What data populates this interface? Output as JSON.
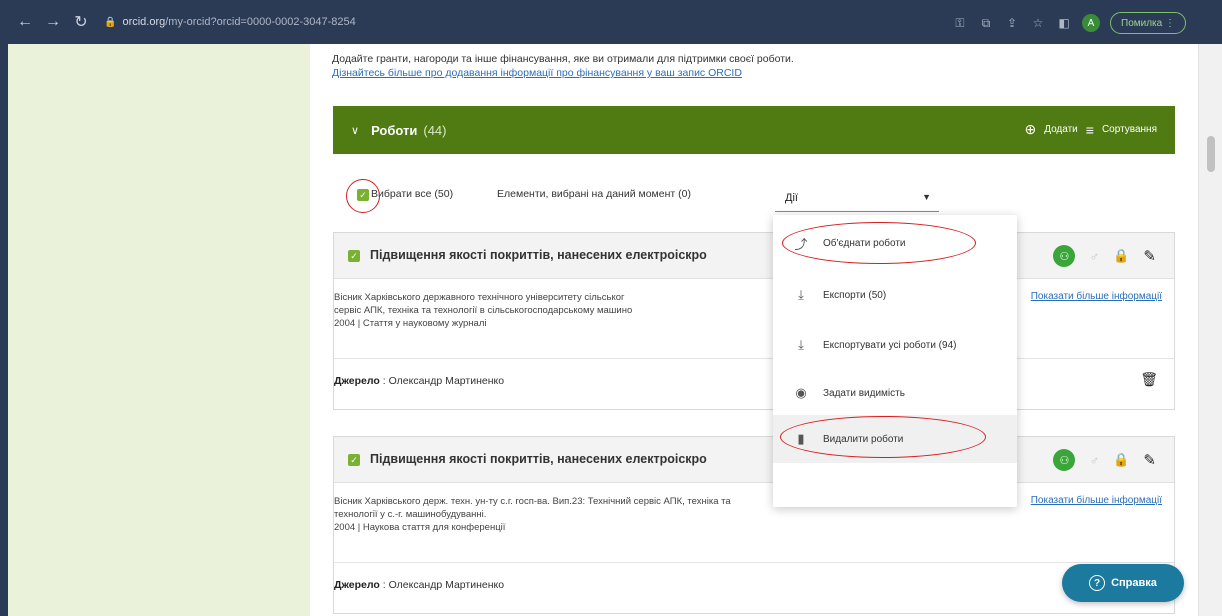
{
  "browser": {
    "url_host": "orcid.org",
    "url_path": "/my-orcid?orcid=0000-0002-3047-8254",
    "pause_label": "Помилка",
    "profile_letter": "А"
  },
  "intro": {
    "text": "Додайте гранти, нагороди та інше фінансування, яке ви отримали для підтримки своєї роботи.",
    "link": "Дізнайтесь більше про додавання інформації про фінансування у ваш запис ORCID"
  },
  "works": {
    "title": "Роботи",
    "count": "(44)",
    "add_label": "Додати",
    "sort_label": "Сортування"
  },
  "selection": {
    "select_all": "Вибрати все (50)",
    "selected_now": "Елементи, вибрані на даний момент (0)",
    "actions_value": "Дії"
  },
  "menu": {
    "items": [
      {
        "label": "Об'єднати роботи",
        "icon": "merge-icon"
      },
      {
        "label": "Експорти (50)",
        "icon": "download-icon"
      },
      {
        "label": "Експортувати усі роботи (94)",
        "icon": "download-all-icon"
      },
      {
        "label": "Задати видимість",
        "icon": "eye-icon"
      },
      {
        "label": "Видалити роботи",
        "icon": "trash-icon"
      }
    ]
  },
  "cards": [
    {
      "title": "Підвищення якості покриттів, нанесених електроіскро",
      "lines": [
        "Вісник Харківського державного технічного університету сільськог",
        "сервіс АПК, техніка та технології в сільськогосподарському машино",
        "2004 | Стаття у науковому журналі"
      ],
      "more": "Показати більше інформації",
      "source_label": "Джерело",
      "source_value": "Олександр Мартиненко"
    },
    {
      "title": "Підвищення якості покриттів, нанесених електроіскро",
      "lines": [
        "Вісник Харківського держ. техн. ун-ту с.г. госп-ва. Вип.23: Технічний сервіс АПК, техніка та",
        "технології у с.-г. машинобудуванні.",
        "2004 | Наукова стаття для конференції"
      ],
      "more": "Показати більше інформації",
      "source_label": "Джерело",
      "source_value": "Олександр Мартиненко"
    }
  ],
  "help": {
    "label": "Справка"
  }
}
